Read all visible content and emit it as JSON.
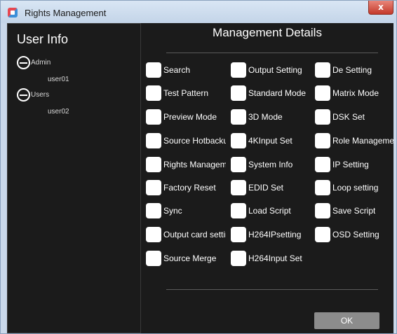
{
  "window": {
    "title": "Rights Management",
    "close_label": "x"
  },
  "left_panel": {
    "title": "User Info",
    "groups": [
      {
        "label": "Admin",
        "users": [
          "user01"
        ]
      },
      {
        "label": "Users",
        "users": [
          "user02"
        ]
      }
    ]
  },
  "right_panel": {
    "title": "Management Details",
    "permissions": [
      "Search",
      "Output Setting",
      "De Setting",
      "Test Pattern",
      "Standard Mode",
      "Matrix Mode",
      "Preview Mode",
      "3D Mode",
      "DSK Set",
      "Source Hotbackup",
      "4KInput Set",
      "Role Management",
      "Rights Management",
      "System Info",
      "IP Setting",
      "Factory Reset",
      "EDID Set",
      "Loop setting",
      "Sync",
      "Load Script",
      "Save Script",
      "Output card setting",
      "H264IPsetting",
      "OSD Setting",
      "Source Merge",
      "H264Input Set"
    ],
    "ok_label": "OK"
  }
}
